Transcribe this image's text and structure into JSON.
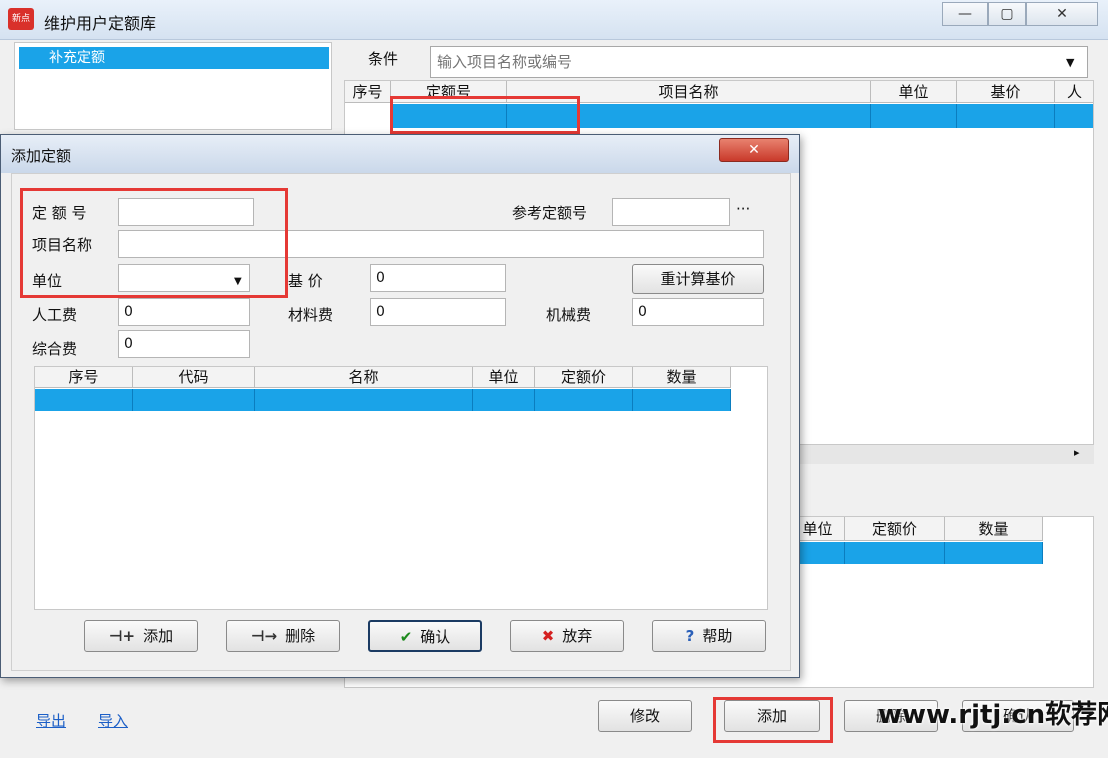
{
  "main_window": {
    "title": "维护用户定额库",
    "app_icon_text": "新点",
    "controls": {
      "minimize": "—",
      "maximize": "▢",
      "close": "✕"
    },
    "tree": {
      "selected_item": "补充定额"
    },
    "search": {
      "label": "条件",
      "placeholder": "输入项目名称或编号"
    },
    "upper_grid": {
      "columns": [
        "序号",
        "定额号",
        "项目名称",
        "单位",
        "基价",
        "人"
      ]
    },
    "lower_grid": {
      "columns": [
        "单位",
        "定额价",
        "数量"
      ]
    },
    "links": {
      "export": "导出",
      "import": "导入"
    },
    "buttons": {
      "modify": "修改",
      "add": "添加",
      "delete": "删除",
      "confirm": "确认"
    }
  },
  "dialog": {
    "title": "添加定额",
    "close_label": "✕",
    "fields": {
      "quota_no": {
        "label": "定 额 号",
        "value": ""
      },
      "ref_quota_no": {
        "label": "参考定额号",
        "value": "",
        "browse": "···"
      },
      "item_name": {
        "label": "项目名称",
        "value": ""
      },
      "unit": {
        "label": "单位",
        "value": ""
      },
      "base_price": {
        "label": "基  价",
        "value": "0"
      },
      "labor_cost": {
        "label": "人工费",
        "value": "0"
      },
      "material_cost": {
        "label": "材料费",
        "value": "0"
      },
      "machine_cost": {
        "label": "机械费",
        "value": "0"
      },
      "overhead_cost": {
        "label": "综合费",
        "value": "0"
      }
    },
    "recalc_button": "重计算基价",
    "grid": {
      "columns": [
        "序号",
        "代码",
        "名称",
        "单位",
        "定额价",
        "数量"
      ]
    },
    "buttons": {
      "add": "添加",
      "delete": "删除",
      "ok": "确认",
      "cancel": "放弃",
      "help": "帮助"
    },
    "icons": {
      "add": "⊣+",
      "delete": "⊣→",
      "ok": "✔",
      "cancel": "✖",
      "help": "?"
    }
  },
  "watermark": "www.rjtj.cn软荐网",
  "colors": {
    "selection": "#1aa3e8",
    "highlight_box": "#e53935"
  }
}
